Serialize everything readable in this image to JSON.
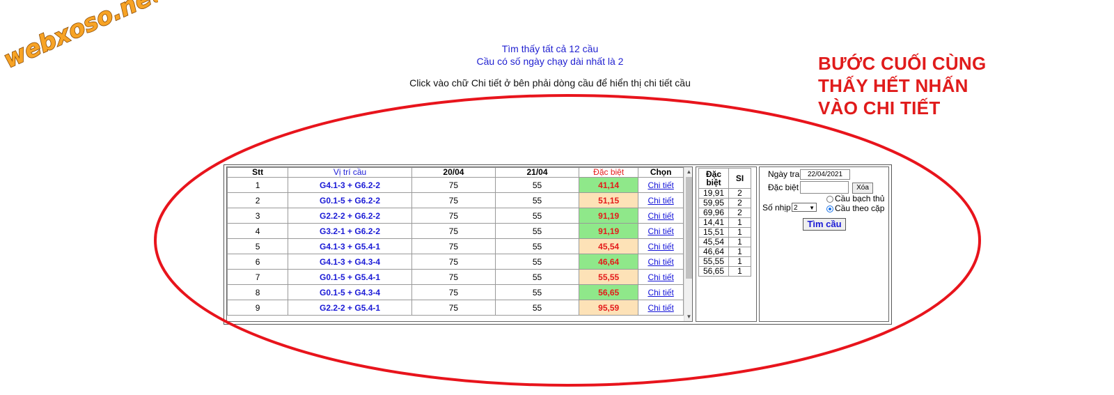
{
  "logo": {
    "text": "webxoso.net"
  },
  "summary": {
    "line1": "Tìm thấy tất cả 12 cầu",
    "line2": "Cầu có số ngày chạy dài nhất là 2"
  },
  "instruction": "Click vào chữ Chi tiết ở bên phải dòng cầu để hiển thị chi tiết cầu",
  "annotation": {
    "line1": "BƯỚC CUỐI CÙNG",
    "line2": "THẤY HẾT NHẤN",
    "line3": "VÀO CHI TIẾT"
  },
  "colors": {
    "annotation": "#e01b1b",
    "link": "#1212d8",
    "position_text": "#1a1ad6",
    "special_text": "#e41b1b",
    "cell_green": "#8fe88a",
    "cell_peach": "#fde2b7"
  },
  "main_table": {
    "headers": {
      "stt": "Stt",
      "position": "Vị trí cầu",
      "day1": "20/04",
      "day2": "21/04",
      "special": "Đặc biệt",
      "choose": "Chọn"
    },
    "rows": [
      {
        "stt": "1",
        "position": "G4.1-3 + G6.2-2",
        "day1": "75",
        "day2": "55",
        "special": "41,14",
        "highlight": "green",
        "link": "Chi tiết"
      },
      {
        "stt": "2",
        "position": "G0.1-5 + G6.2-2",
        "day1": "75",
        "day2": "55",
        "special": "51,15",
        "highlight": "peach",
        "link": "Chi tiết"
      },
      {
        "stt": "3",
        "position": "G2.2-2 + G6.2-2",
        "day1": "75",
        "day2": "55",
        "special": "91,19",
        "highlight": "green",
        "link": "Chi tiết"
      },
      {
        "stt": "4",
        "position": "G3.2-1 + G6.2-2",
        "day1": "75",
        "day2": "55",
        "special": "91,19",
        "highlight": "green",
        "link": "Chi tiết"
      },
      {
        "stt": "5",
        "position": "G4.1-3 + G5.4-1",
        "day1": "75",
        "day2": "55",
        "special": "45,54",
        "highlight": "peach",
        "link": "Chi tiết"
      },
      {
        "stt": "6",
        "position": "G4.1-3 + G4.3-4",
        "day1": "75",
        "day2": "55",
        "special": "46,64",
        "highlight": "green",
        "link": "Chi tiết"
      },
      {
        "stt": "7",
        "position": "G0.1-5 + G5.4-1",
        "day1": "75",
        "day2": "55",
        "special": "55,55",
        "highlight": "peach",
        "link": "Chi tiết"
      },
      {
        "stt": "8",
        "position": "G0.1-5 + G4.3-4",
        "day1": "75",
        "day2": "55",
        "special": "56,65",
        "highlight": "green",
        "link": "Chi tiết"
      },
      {
        "stt": "9",
        "position": "G2.2-2 + G5.4-1",
        "day1": "75",
        "day2": "55",
        "special": "95,59",
        "highlight": "peach",
        "link": "Chi tiết"
      }
    ]
  },
  "stats_table": {
    "header_special_line1": "Đặc",
    "header_special_line2": "biệt",
    "header_count": "SI",
    "rows": [
      {
        "value": "19,91",
        "count": "2"
      },
      {
        "value": "59,95",
        "count": "2"
      },
      {
        "value": "69,96",
        "count": "2"
      },
      {
        "value": "14,41",
        "count": "1"
      },
      {
        "value": "15,51",
        "count": "1"
      },
      {
        "value": "45,54",
        "count": "1"
      },
      {
        "value": "46,64",
        "count": "1"
      },
      {
        "value": "55,55",
        "count": "1"
      },
      {
        "value": "56,65",
        "count": "1"
      }
    ]
  },
  "search_form": {
    "date_label": "Ngày tra",
    "date_value": "22/04/2021",
    "special_label": "Đặc biệt",
    "special_value": "",
    "clear_button": "Xóa",
    "rhythm_label": "Số nhịp",
    "rhythm_value": "2",
    "option_single": "Cầu bạch thủ",
    "option_pair": "Cầu theo cặp",
    "selected_option": "pair",
    "find_button": "Tìm cầu"
  }
}
